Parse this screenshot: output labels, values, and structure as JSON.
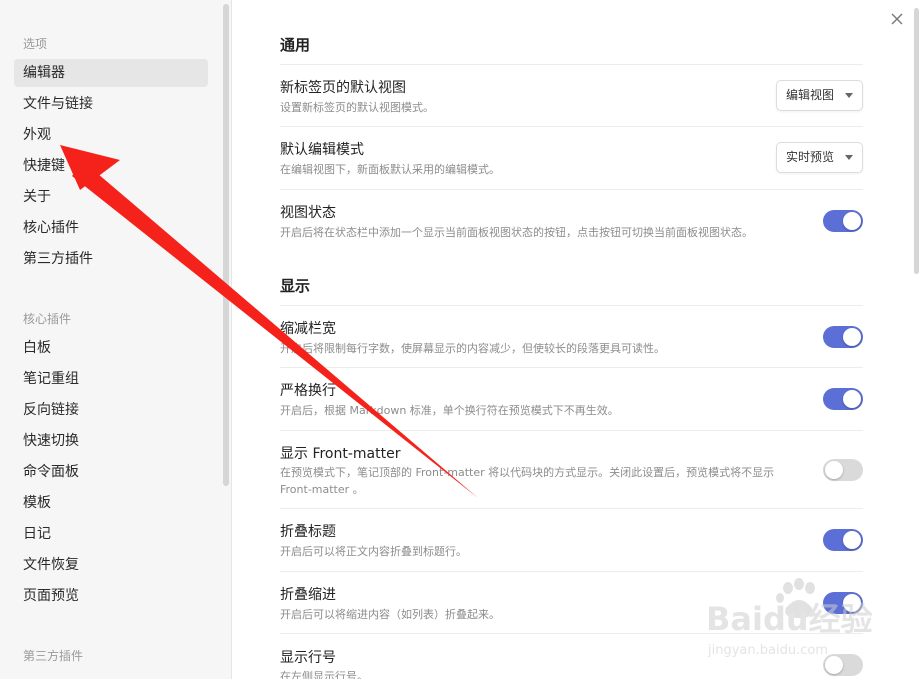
{
  "sidebar": {
    "section_options": "选项",
    "options_items": [
      {
        "label": "编辑器",
        "active": true
      },
      {
        "label": "文件与链接"
      },
      {
        "label": "外观"
      },
      {
        "label": "快捷键"
      },
      {
        "label": "关于"
      },
      {
        "label": "核心插件"
      },
      {
        "label": "第三方插件"
      }
    ],
    "section_core": "核心插件",
    "core_items": [
      {
        "label": "白板"
      },
      {
        "label": "笔记重组"
      },
      {
        "label": "反向链接"
      },
      {
        "label": "快速切换"
      },
      {
        "label": "命令面板"
      },
      {
        "label": "模板"
      },
      {
        "label": "日记"
      },
      {
        "label": "文件恢复"
      },
      {
        "label": "页面预览"
      }
    ],
    "section_third": "第三方插件"
  },
  "main": {
    "section_general": "通用",
    "section_display": "显示",
    "settings": [
      {
        "title": "新标签页的默认视图",
        "desc": "设置新标签页的默认视图模式。",
        "control": "dropdown",
        "value": "编辑视图"
      },
      {
        "title": "默认编辑模式",
        "desc": "在编辑视图下，新面板默认采用的编辑模式。",
        "control": "dropdown",
        "value": "实时预览"
      },
      {
        "title": "视图状态",
        "desc": "开启后将在状态栏中添加一个显示当前面板视图状态的按钮，点击按钮可切换当前面板视图状态。",
        "control": "toggle",
        "on": true
      },
      {
        "title": "缩减栏宽",
        "desc": "开启后将限制每行字数，使屏幕显示的内容减少，但使较长的段落更具可读性。",
        "control": "toggle",
        "on": true
      },
      {
        "title": "严格换行",
        "desc": "开启后，根据 Markdown 标准，单个换行符在预览模式下不再生效。",
        "control": "toggle",
        "on": true
      },
      {
        "title": "显示 Front-matter",
        "desc": "在预览模式下，笔记顶部的 Front-matter 将以代码块的方式显示。关闭此设置后，预览模式将不显示 Front-matter 。",
        "control": "toggle",
        "on": false
      },
      {
        "title": "折叠标题",
        "desc": "开启后可以将正文内容折叠到标题行。",
        "control": "toggle",
        "on": true
      },
      {
        "title": "折叠缩进",
        "desc": "开启后可以将缩进内容（如列表）折叠起来。",
        "control": "toggle",
        "on": true
      },
      {
        "title": "显示行号",
        "desc": "在左侧显示行号。",
        "control": "toggle",
        "on": false
      }
    ],
    "close_icon": "close-icon"
  },
  "overlay": {
    "arrow_color": "#f5221c",
    "watermark_brand": "Baidu经验",
    "watermark_url": "jingyan.baidu.com"
  },
  "colors": {
    "toggle_on": "#5b6fd6",
    "toggle_off": "#dadada",
    "sidebar_bg": "#f6f6f6"
  }
}
